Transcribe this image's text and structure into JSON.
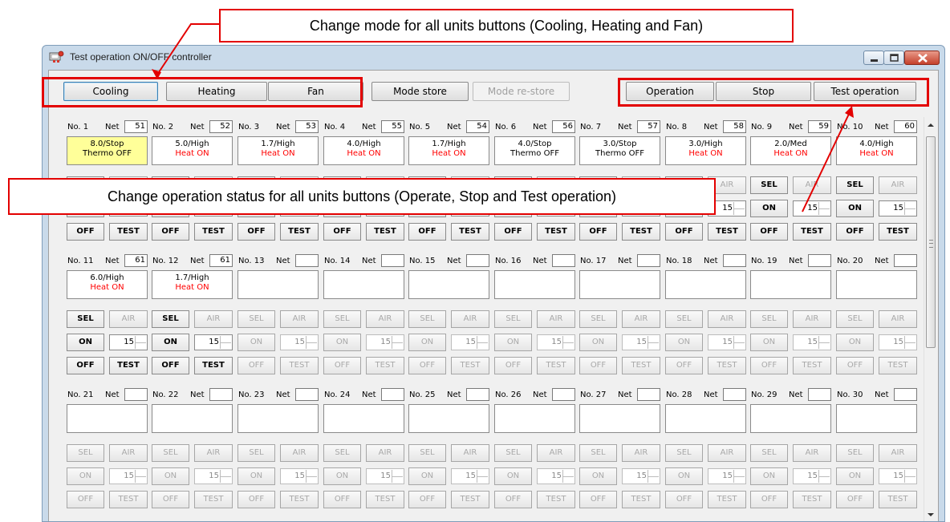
{
  "annotations": {
    "mode_callout": "Change mode for all units buttons (Cooling, Heating and Fan)",
    "status_callout": "Change operation status for all units buttons (Operate, Stop and Test operation)"
  },
  "window": {
    "title": "Test operation ON/OFF controller",
    "controls": [
      "minimize-icon",
      "maximize-icon",
      "close-icon"
    ]
  },
  "toolbar": {
    "cooling": "Cooling",
    "heating": "Heating",
    "fan": "Fan",
    "mode_store": "Mode store",
    "mode_restore": "Mode re-store",
    "operation": "Operation",
    "stop": "Stop",
    "test_operation": "Test operation"
  },
  "unit_labels": {
    "net": "Net",
    "sel": "SEL",
    "air": "AIR",
    "on": "ON",
    "off": "OFF",
    "test": "TEST"
  },
  "units": [
    {
      "no": "No. 1",
      "net": "51",
      "l1": "8.0/Stop",
      "l2": "Thermo OFF",
      "l2_color": "black",
      "yellow": true,
      "active": true,
      "timer": "15"
    },
    {
      "no": "No. 2",
      "net": "52",
      "l1": "5.0/High",
      "l2": "Heat ON",
      "l2_color": "red",
      "active": true,
      "timer": "15"
    },
    {
      "no": "No. 3",
      "net": "53",
      "l1": "1.7/High",
      "l2": "Heat ON",
      "l2_color": "red",
      "active": true,
      "timer": "15"
    },
    {
      "no": "No. 4",
      "net": "55",
      "l1": "4.0/High",
      "l2": "Heat ON",
      "l2_color": "red",
      "active": true,
      "timer": "15"
    },
    {
      "no": "No. 5",
      "net": "54",
      "l1": "1.7/High",
      "l2": "Heat ON",
      "l2_color": "red",
      "active": true,
      "timer": "15"
    },
    {
      "no": "No. 6",
      "net": "56",
      "l1": "4.0/Stop",
      "l2": "Thermo OFF",
      "l2_color": "black",
      "active": true,
      "timer": "15"
    },
    {
      "no": "No. 7",
      "net": "57",
      "l1": "3.0/Stop",
      "l2": "Thermo OFF",
      "l2_color": "black",
      "active": true,
      "timer": "15"
    },
    {
      "no": "No. 8",
      "net": "58",
      "l1": "3.0/High",
      "l2": "Heat ON",
      "l2_color": "red",
      "active": true,
      "timer": "15"
    },
    {
      "no": "No. 9",
      "net": "59",
      "l1": "2.0/Med",
      "l2": "Heat ON",
      "l2_color": "red",
      "active": true,
      "timer": "15"
    },
    {
      "no": "No. 10",
      "net": "60",
      "l1": "4.0/High",
      "l2": "Heat ON",
      "l2_color": "red",
      "active": true,
      "timer": "15"
    },
    {
      "no": "No. 11",
      "net": "61",
      "l1": "6.0/High",
      "l2": "Heat ON",
      "l2_color": "red",
      "active": true,
      "timer": "15"
    },
    {
      "no": "No. 12",
      "net": "61",
      "l1": "1.7/High",
      "l2": "Heat ON",
      "l2_color": "red",
      "active": true,
      "timer": "15"
    },
    {
      "no": "No. 13",
      "net": "",
      "l1": "",
      "l2": "",
      "active": false,
      "timer": "15"
    },
    {
      "no": "No. 14",
      "net": "",
      "l1": "",
      "l2": "",
      "active": false,
      "timer": "15"
    },
    {
      "no": "No. 15",
      "net": "",
      "l1": "",
      "l2": "",
      "active": false,
      "timer": "15"
    },
    {
      "no": "No. 16",
      "net": "",
      "l1": "",
      "l2": "",
      "active": false,
      "timer": "15"
    },
    {
      "no": "No. 17",
      "net": "",
      "l1": "",
      "l2": "",
      "active": false,
      "timer": "15"
    },
    {
      "no": "No. 18",
      "net": "",
      "l1": "",
      "l2": "",
      "active": false,
      "timer": "15"
    },
    {
      "no": "No. 19",
      "net": "",
      "l1": "",
      "l2": "",
      "active": false,
      "timer": "15"
    },
    {
      "no": "No. 20",
      "net": "",
      "l1": "",
      "l2": "",
      "active": false,
      "timer": "15"
    },
    {
      "no": "No. 21",
      "net": "",
      "l1": "",
      "l2": "",
      "active": false,
      "timer": "15"
    },
    {
      "no": "No. 22",
      "net": "",
      "l1": "",
      "l2": "",
      "active": false,
      "timer": "15"
    },
    {
      "no": "No. 23",
      "net": "",
      "l1": "",
      "l2": "",
      "active": false,
      "timer": "15"
    },
    {
      "no": "No. 24",
      "net": "",
      "l1": "",
      "l2": "",
      "active": false,
      "timer": "15"
    },
    {
      "no": "No. 25",
      "net": "",
      "l1": "",
      "l2": "",
      "active": false,
      "timer": "15"
    },
    {
      "no": "No. 26",
      "net": "",
      "l1": "",
      "l2": "",
      "active": false,
      "timer": "15"
    },
    {
      "no": "No. 27",
      "net": "",
      "l1": "",
      "l2": "",
      "active": false,
      "timer": "15"
    },
    {
      "no": "No. 28",
      "net": "",
      "l1": "",
      "l2": "",
      "active": false,
      "timer": "15"
    },
    {
      "no": "No. 29",
      "net": "",
      "l1": "",
      "l2": "",
      "active": false,
      "timer": "15"
    },
    {
      "no": "No. 30",
      "net": "",
      "l1": "",
      "l2": "",
      "active": false,
      "timer": "15"
    }
  ],
  "colors": {
    "annotation_red": "#e30000",
    "thermo_highlight": "#ffff99",
    "heat_on_text": "#ff0000"
  }
}
